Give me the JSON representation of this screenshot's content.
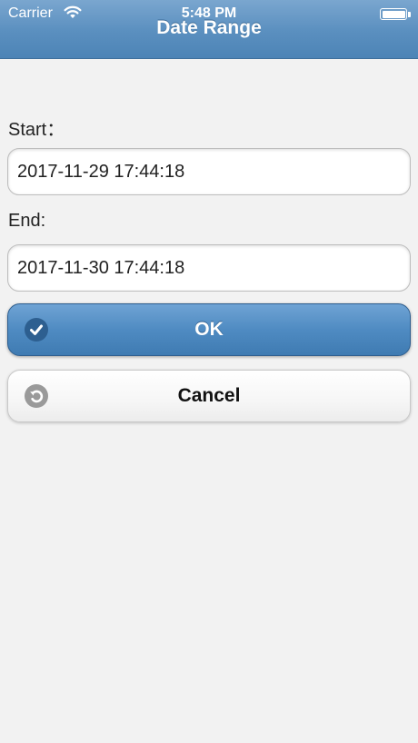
{
  "status_bar": {
    "carrier": "Carrier",
    "time": "5:48 PM"
  },
  "header": {
    "title": "Date Range"
  },
  "form": {
    "start_label": "Start：",
    "start_value": "2017-11-29 17:44:18",
    "end_label": "End:",
    "end_value": "2017-11-30 17:44:18"
  },
  "buttons": {
    "ok_label": "OK",
    "cancel_label": "Cancel"
  },
  "colors": {
    "header": "#5a8fbf",
    "ok_button": "#4f8bc2",
    "background": "#f2f2f2"
  },
  "icons": {
    "ok": "check-circle-icon",
    "cancel": "undo-circle-icon",
    "wifi": "wifi-icon",
    "battery": "battery-icon"
  }
}
